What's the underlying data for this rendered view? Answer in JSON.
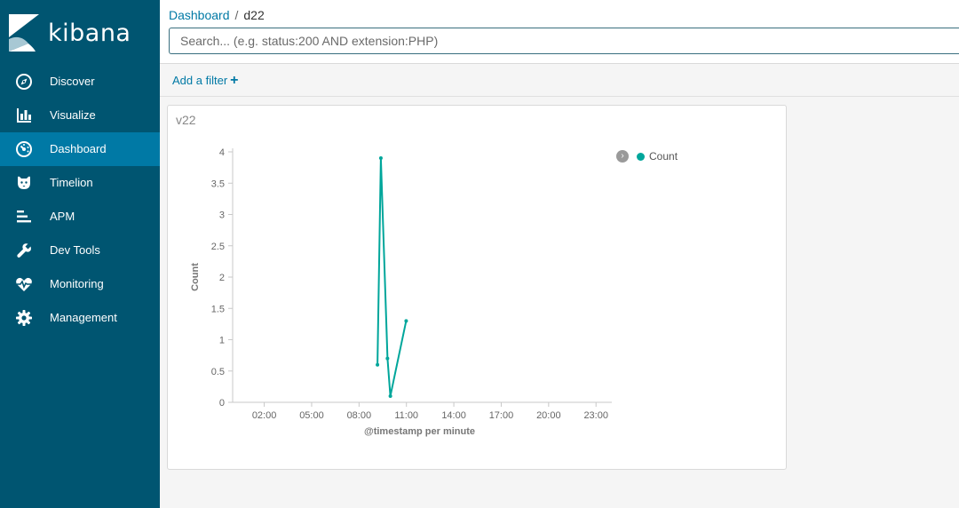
{
  "app": {
    "brand": "kibana",
    "accent_color": "#0079a5",
    "sidebar_color": "#005571"
  },
  "sidebar": {
    "items": [
      {
        "label": "Discover",
        "icon": "compass-icon"
      },
      {
        "label": "Visualize",
        "icon": "bar-chart-icon"
      },
      {
        "label": "Dashboard",
        "icon": "dashboard-icon",
        "active": true
      },
      {
        "label": "Timelion",
        "icon": "timelion-icon"
      },
      {
        "label": "APM",
        "icon": "apm-icon"
      },
      {
        "label": "Dev Tools",
        "icon": "wrench-icon"
      },
      {
        "label": "Monitoring",
        "icon": "heartbeat-icon"
      },
      {
        "label": "Management",
        "icon": "gear-icon"
      }
    ]
  },
  "breadcrumb": {
    "parent": "Dashboard",
    "separator": "/",
    "current": "d22"
  },
  "search": {
    "placeholder": "Search... (e.g. status:200 AND extension:PHP)",
    "value": ""
  },
  "filters": {
    "add_label": "Add a filter",
    "add_icon": "plus-icon"
  },
  "panel": {
    "title": "v22"
  },
  "chart_data": {
    "type": "line",
    "xlabel": "@timestamp per minute",
    "ylabel": "Count",
    "x_ticks": [
      "02:00",
      "05:00",
      "08:00",
      "11:00",
      "14:00",
      "17:00",
      "20:00",
      "23:00"
    ],
    "y_ticks": [
      "0",
      "0.5",
      "1",
      "1.5",
      "2",
      "2.5",
      "3",
      "3.5",
      "4"
    ],
    "ylim": [
      0,
      4
    ],
    "x_range_hours": [
      0,
      24
    ],
    "series": [
      {
        "name": "Count",
        "color": "#00a69b",
        "points": [
          {
            "x": "09:10",
            "y": 0.6
          },
          {
            "x": "09:23",
            "y": 3.9
          },
          {
            "x": "09:48",
            "y": 0.7
          },
          {
            "x": "09:59",
            "y": 0.1
          },
          {
            "x": "10:59",
            "y": 1.3
          }
        ]
      }
    ],
    "legend_position": "top-right",
    "grid": false
  }
}
